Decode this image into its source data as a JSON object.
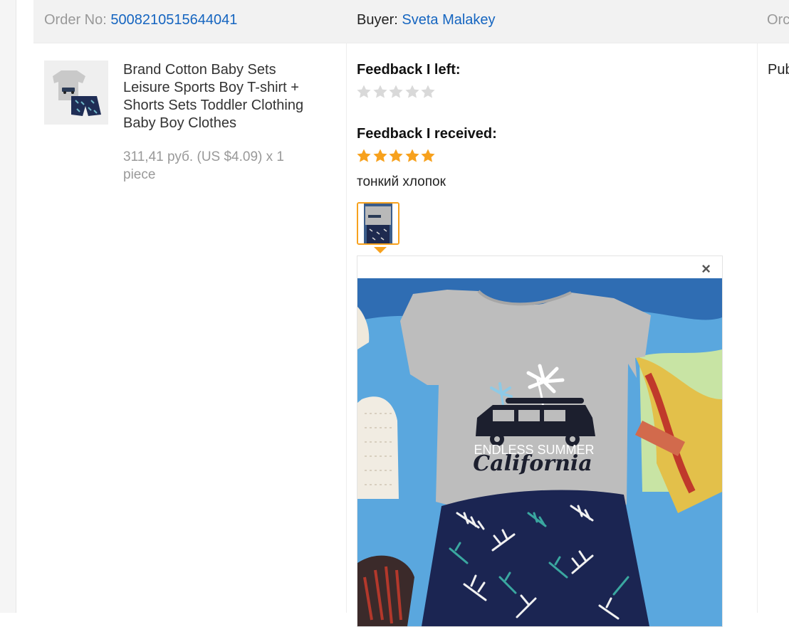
{
  "order": {
    "number_label": "Order No:",
    "number_value": "5008210515644041",
    "buyer_label": "Buyer:",
    "buyer_name": "Sveta Malakey",
    "extra_header": "Orc"
  },
  "product": {
    "title": "Brand Cotton Baby Sets Leisure Sports Boy T-shirt + Shorts Sets Toddler Clothing Baby Boy Clothes",
    "price": "311,41 руб. (US $4.09) x 1 piece"
  },
  "feedback": {
    "left_label": "Feedback I left:",
    "left_rating": 0,
    "received_label": "Feedback I received:",
    "received_rating": 5,
    "received_comment": "тонкий хлопок",
    "star_empty_color": "#d9d9d9",
    "star_filled_color": "#f7a11d"
  },
  "photo_viewer": {
    "close_symbol": "×",
    "image_text_1": "ENDLESS SUMMER",
    "image_text_2": "California"
  },
  "column3": {
    "text": "Pub"
  }
}
